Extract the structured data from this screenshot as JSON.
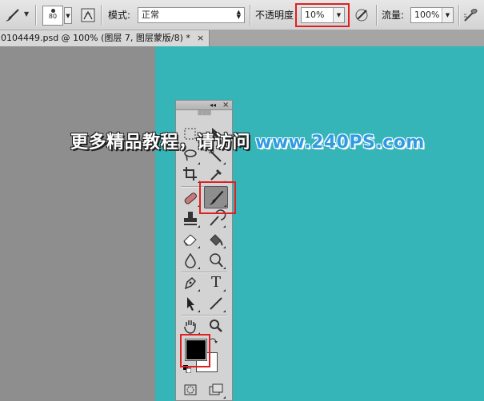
{
  "options_bar": {
    "brush_size": "80",
    "mode_label": "模式:",
    "mode_value": "正常",
    "opacity_label": "不透明度",
    "opacity_value": "10%",
    "flow_label": "流量:",
    "flow_value": "100%"
  },
  "document_tab": {
    "title": "0104449.psd @ 100% (图层 7, 图层蒙版/8) *",
    "close": "×"
  },
  "toolbox": {
    "collapse": "◂◂",
    "close": "×",
    "grip": "||||||||||||||||",
    "type_tool_glyph": "T"
  },
  "watermark": {
    "chinese": "更多精品教程，请访问",
    "url": "www.240PS.com"
  },
  "colors": {
    "canvas": "#35b5b8",
    "foreground": "#000000",
    "background": "#ffffff",
    "highlight": "#e02020"
  }
}
